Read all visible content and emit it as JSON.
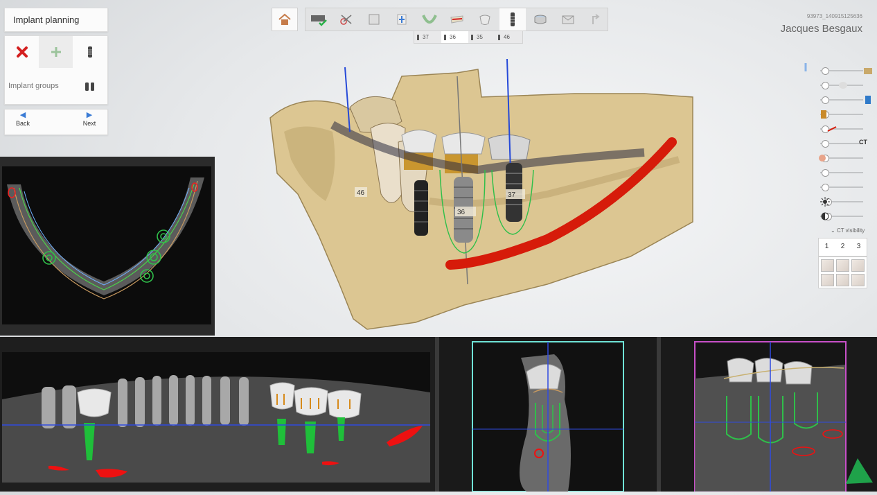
{
  "header": {
    "title": "Implant planning"
  },
  "tools": {
    "delete_icon": "red-x-icon",
    "add_icon": "plus-icon",
    "implant_icon": "implant-icon",
    "groups_label": "Implant groups",
    "groups_icon": "implant-groups-icon"
  },
  "nav": {
    "back_label": "Back",
    "next_label": "Next"
  },
  "toolbar": {
    "items": [
      "home-icon",
      "scan-import-icon",
      "segmentation-icon",
      "ct-slice-icon",
      "alignment-icon",
      "arch-curve-icon",
      "nerve-icon",
      "crown-icon",
      "implant-icon",
      "sleeve-icon",
      "guide-icon",
      "export-icon"
    ]
  },
  "tooth_tabs": [
    "37",
    "36",
    "35",
    "46"
  ],
  "patient": {
    "id": "93973_140915125636",
    "name": "Jacques Besgaux"
  },
  "controls": {
    "ct_label": "CT",
    "ct_visibility_label": "CT visibility",
    "view_numbers": [
      "1",
      "2",
      "3"
    ]
  },
  "scene_labels": {
    "tooth_46": "46",
    "tooth_36": "36",
    "tooth_37": "37"
  },
  "colors": {
    "bone": "#d9c590",
    "nerve": "#d61b0a",
    "implant_outline": "#2fbf4a",
    "axis_blue": "#2549d8",
    "cross_frame_teal": "#6fe3d6",
    "cross_frame_magenta": "#c850c8"
  }
}
